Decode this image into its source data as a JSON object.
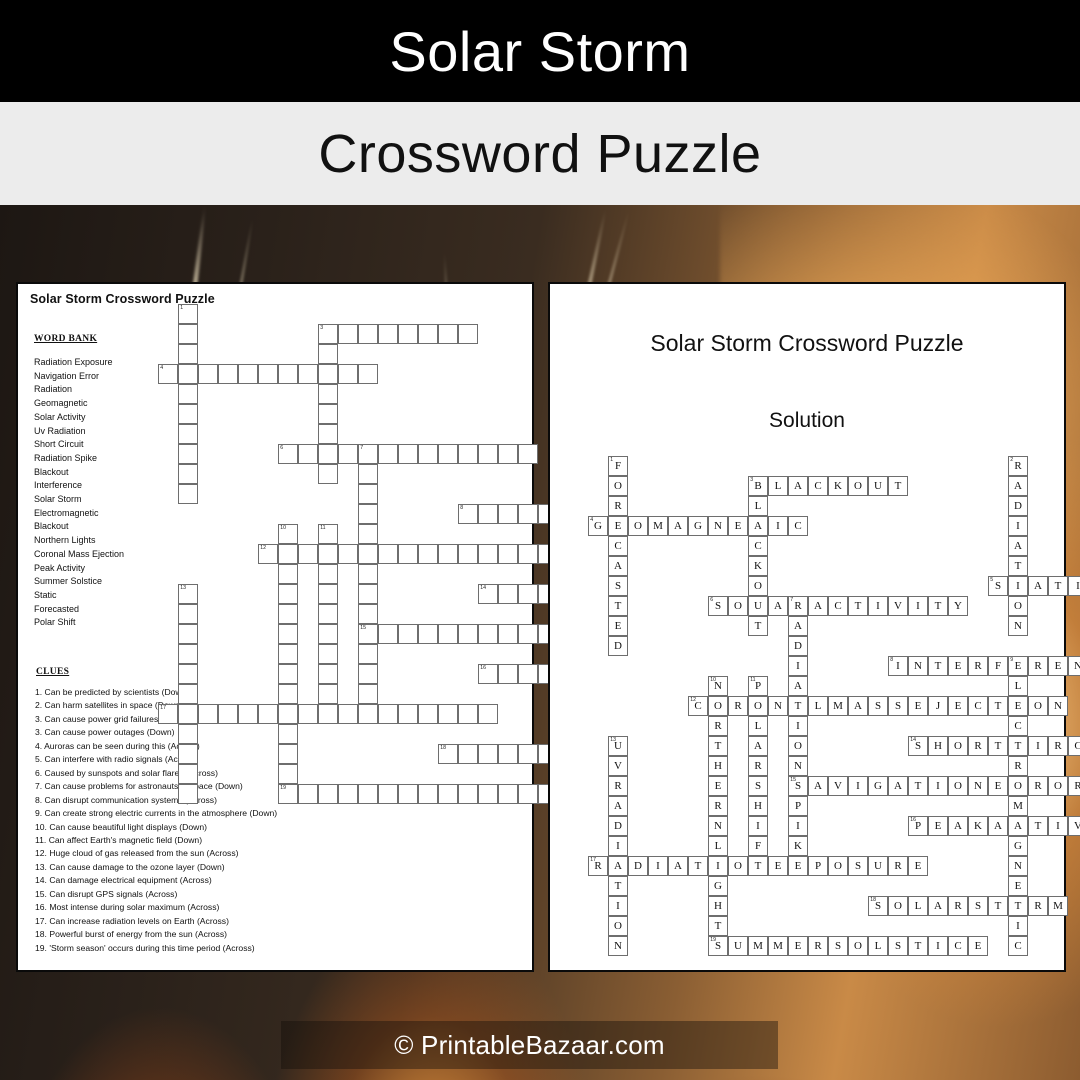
{
  "header": {
    "title": "Solar Storm",
    "subtitle": "Crossword Puzzle"
  },
  "footer": {
    "watermark": "© PrintableBazaar.com"
  },
  "puzzle_sheet": {
    "sheet_title": "Solar Storm Crossword Puzzle",
    "word_bank_heading": "WORD BANK",
    "word_bank": [
      "Radiation Exposure",
      "Navigation Error",
      "Radiation",
      "Geomagnetic",
      "Solar Activity",
      "Uv Radiation",
      "Short  Circuit",
      "Radiation Spike",
      "Blackout",
      "Interference",
      "Solar Storm",
      "Electromagnetic",
      "Blackout",
      "Northern  Lights",
      "Coronal Mass Ejection",
      "Peak Activity",
      "Summer  Solstice",
      "Static",
      "Forecasted",
      "Polar Shift"
    ],
    "clues_heading": "CLUES",
    "clues": [
      "1. Can be predicted by scientists (Down)",
      "2. Can harm satellites in space (Down)",
      "3. Can cause power grid failures (Across)",
      "3. Can cause power outages (Down)",
      "4. Auroras can be seen during this (Across)",
      "5. Can interfere with radio signals (Across)",
      "6. Caused by sunspots and solar flares (Across)",
      "7. Can cause problems for astronauts in space (Down)",
      "8. Can disrupt communication  systems (Across)",
      "9. Can create strong electric currents in the atmosphere (Down)",
      "10. Can cause beautiful light displays (Down)",
      "11. Can affect Earth's magnetic field (Down)",
      "12. Huge cloud of gas released from the sun (Across)",
      "13. Can cause damage to the ozone  layer (Down)",
      "14. Can damage electrical equipment (Across)",
      "15. Can disrupt GPS signals (Across)",
      "16. Most intense during solar maximum  (Across)",
      "17. Can increase radiation levels on Earth (Across)",
      "18. Powerful burst of energy from the sun (Across)",
      "19. 'Storm  season' occurs during this time period (Across)"
    ]
  },
  "solution_sheet": {
    "title": "Solar Storm Crossword Puzzle",
    "subtitle": "Solution"
  },
  "crossword": {
    "cell_size": 20,
    "entries": [
      {
        "number": 1,
        "dir": "down",
        "answer": "FORECASTED",
        "col": 1,
        "row": 0
      },
      {
        "number": 2,
        "dir": "down",
        "answer": "RADIATION",
        "col": 21,
        "row": 0
      },
      {
        "number": 3,
        "dir": "across",
        "answer": "BLACKOUT",
        "col": 8,
        "row": 1
      },
      {
        "number": 3,
        "dir": "down",
        "answer": "BLACKOUT",
        "col": 8,
        "row": 1
      },
      {
        "number": 4,
        "dir": "across",
        "answer": "GEOMAGNETIC",
        "col": 0,
        "row": 3
      },
      {
        "number": 5,
        "dir": "across",
        "answer": "STATIC",
        "col": 20,
        "row": 6
      },
      {
        "number": 6,
        "dir": "across",
        "answer": "SOLARACTIVITY",
        "col": 6,
        "row": 7
      },
      {
        "number": 7,
        "dir": "down",
        "answer": "RADIATIONSPIKE",
        "col": 10,
        "row": 7
      },
      {
        "number": 8,
        "dir": "across",
        "answer": "INTERFERENCE",
        "col": 15,
        "row": 10
      },
      {
        "number": 9,
        "dir": "down",
        "answer": "ELECTROMAGNETIC",
        "col": 21,
        "row": 10
      },
      {
        "number": 10,
        "dir": "down",
        "answer": "NORTHERNLIGHTS",
        "col": 6,
        "row": 11
      },
      {
        "number": 11,
        "dir": "down",
        "answer": "POLARSHIFT",
        "col": 8,
        "row": 11
      },
      {
        "number": 12,
        "dir": "across",
        "answer": "CORONALMASSEJECTION",
        "col": 5,
        "row": 12
      },
      {
        "number": 13,
        "dir": "down",
        "answer": "UVRADIATION",
        "col": 1,
        "row": 14
      },
      {
        "number": 14,
        "dir": "across",
        "answer": "SHORTCIRCUIT",
        "col": 16,
        "row": 14
      },
      {
        "number": 15,
        "dir": "across",
        "answer": "NAVIGATIONERROR",
        "col": 10,
        "row": 16
      },
      {
        "number": 16,
        "dir": "across",
        "answer": "PEAKACTIVITY",
        "col": 16,
        "row": 18
      },
      {
        "number": 17,
        "dir": "across",
        "answer": "RADIATIONEXPOSURE",
        "col": 0,
        "row": 20
      },
      {
        "number": 18,
        "dir": "across",
        "answer": "SOLARSTORM",
        "col": 14,
        "row": 22
      },
      {
        "number": 19,
        "dir": "across",
        "answer": "SUMMERSOLSTICE",
        "col": 6,
        "row": 24
      }
    ]
  }
}
